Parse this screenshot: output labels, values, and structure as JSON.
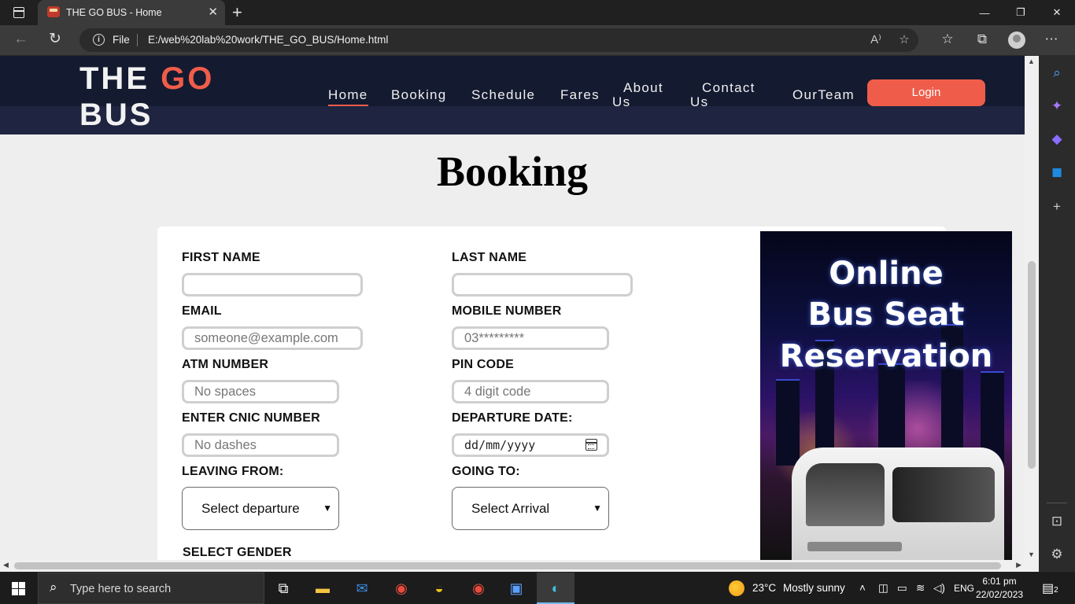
{
  "browser": {
    "tab_title": "THE GO BUS - Home",
    "tab_close": "✕",
    "new_tab": "+",
    "protocol_label": "File",
    "url": "E:/web%20lab%20work/THE_GO_BUS/Home.html"
  },
  "site": {
    "logo_line1_a": "THE ",
    "logo_line1_b": "GO",
    "logo_line2": "BUS",
    "nav": {
      "home": "Home",
      "booking": "Booking",
      "schedule": "Schedule",
      "fares": "Fares",
      "about_1": "About",
      "about_2": "Us",
      "contact_1": "Contact",
      "contact_2": "Us",
      "team": "OurTeam"
    },
    "login_label": "Login",
    "accent_color": "#ef5d4a",
    "header_color": "#141a30"
  },
  "booking": {
    "heading": "Booking",
    "first_name_label": "FIRST NAME",
    "last_name_label": "LAST NAME",
    "email_label": "EMAIL",
    "email_placeholder": "someone@example.com",
    "mobile_label": "MOBILE NUMBER",
    "mobile_placeholder": "03*********",
    "atm_label": "ATM NUMBER",
    "atm_placeholder": "No spaces",
    "pin_label": "PIN CODE",
    "pin_placeholder": "4 digit code",
    "cnic_label": "ENTER CNIC NUMBER",
    "cnic_placeholder": "No dashes",
    "departure_date_label": "DEPARTURE DATE:",
    "departure_date_placeholder": "dd/mm/yyyy",
    "leaving_label": "LEAVING FROM:",
    "leaving_value": "Select departure",
    "going_label": "GOING TO:",
    "going_value": "Select Arrival",
    "gender_label": "SELECT GENDER"
  },
  "promo": {
    "line1": "Online",
    "line2": "Bus Seat",
    "line3": "Reservation"
  },
  "taskbar": {
    "search_placeholder": "Type here to search",
    "temperature": "23°C",
    "weather": "Mostly sunny",
    "language": "ENG",
    "time": "6:01 pm",
    "date": "22/02/2023",
    "notification_count": "2"
  }
}
